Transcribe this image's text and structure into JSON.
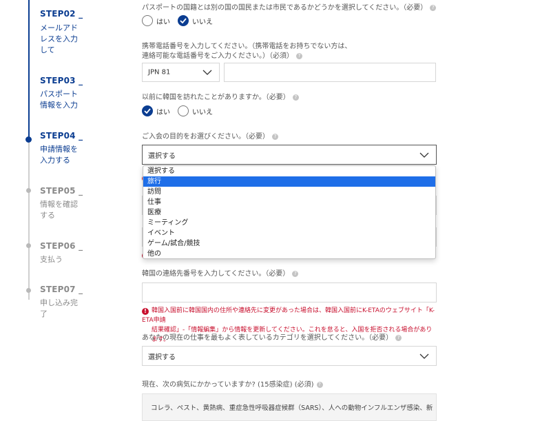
{
  "steps": [
    {
      "title": "STEP02 _",
      "desc": "メールアドレスを入力して",
      "state": "done"
    },
    {
      "title": "STEP03 _",
      "desc": "パスポート情報を入力",
      "state": "done"
    },
    {
      "title": "STEP04 _",
      "desc": "申請情報を入力する",
      "state": "current"
    },
    {
      "title": "STEP05 _",
      "desc": "情報を確認する",
      "state": "todo"
    },
    {
      "title": "STEP06 _",
      "desc": "支払う",
      "state": "todo"
    },
    {
      "title": "STEP07 _",
      "desc": "申し込み完了",
      "state": "todo"
    }
  ],
  "form": {
    "dual_nationality": {
      "question": "パスポートの国籍とは別の国の国民または市民であるかどうかを選択してください。（必要）",
      "yes": "はい",
      "no": "いいえ",
      "selected": "no"
    },
    "phone": {
      "question_line1": "携帯電話番号を入力してください。（携帯電話をお持ちでない方は、",
      "question_line2": "連絡可能な電話番号をご入力ください。）（必須）",
      "country_code": "JPN 81",
      "number": ""
    },
    "visited_before": {
      "question": "以前に韓国を訪れたことがありますか。（必要）",
      "yes": "はい",
      "no": "いいえ",
      "selected": "yes"
    },
    "purpose": {
      "question": "ご入会の目的をお選びください。（必要）",
      "value": "選択する",
      "options": [
        "選択する",
        "旅行",
        "訪問",
        "仕事",
        "医療",
        "ミーティング",
        "イベント",
        "ゲーム/試合/競技",
        "他の"
      ],
      "highlighted": "旅行"
    },
    "korea_contact": {
      "question": "韓国の連絡先番号を入力してください。（必要）",
      "value": "",
      "warning_line1": "韓国入国前に韓国国内の住所や連絡先に変更があった場合は、韓国入国前にK-ETAのウェブサイト「K-ETA申請",
      "warning_line2": "結果確認」-「情報編集」から情報を更新してください。これを怠ると、入国を拒否される場合があります。"
    },
    "job_category": {
      "question": "あなたの現在の仕事を最もよく表しているカテゴリを選択してください。（必要）",
      "value": "選択する"
    },
    "disease": {
      "question": "現在、次の病気にかかっていますか? (15感染症) (必須)",
      "list_text": "コレラ、ペスト、黄熱病、重症急性呼吸器症候群（SARS）、人への動物インフルエンザ感染、新型インフ"
    }
  },
  "colors": {
    "primary": "#0b3d91",
    "highlight": "#1e6ee8",
    "error": "#c8102e",
    "inactive": "#8a8a8a"
  },
  "icons": {
    "help": "question-circle-icon",
    "chevron": "chevron-down-icon",
    "check": "check-icon",
    "error": "error-circle-icon"
  }
}
